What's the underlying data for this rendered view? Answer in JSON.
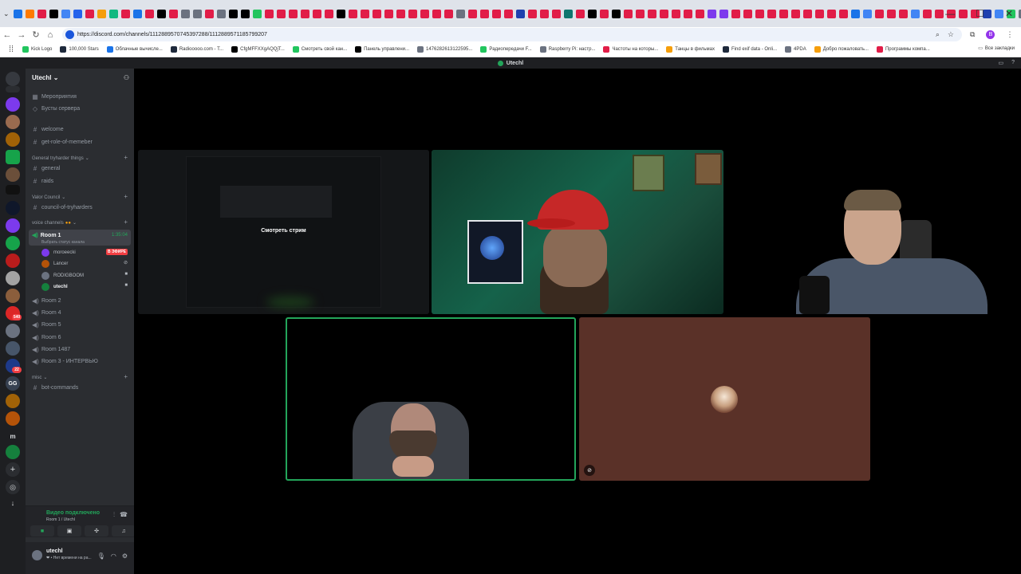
{
  "browser": {
    "url": "https://discord.com/channels/1112889570745397288/1112889571185799207",
    "tab_colors": [
      "#1a73e8",
      "#ff7a00",
      "#e11d48",
      "#000000",
      "#4285f4",
      "#2563eb",
      "#e11d48",
      "#f59e0b",
      "#10b981",
      "#e11d48",
      "#1a73e8",
      "#e11d48",
      "#000000",
      "#e11d48",
      "#6b7280",
      "#6b7280",
      "#e11d48",
      "#6b7280",
      "#000000",
      "#000000",
      "#22c55e",
      "#e11d48",
      "#e11d48",
      "#e11d48",
      "#e11d48",
      "#e11d48",
      "#e11d48",
      "#000000",
      "#e11d48",
      "#e11d48",
      "#e11d48",
      "#e11d48",
      "#e11d48",
      "#e11d48",
      "#e11d48",
      "#e11d48",
      "#e11d48",
      "#6b7280",
      "#e11d48",
      "#e11d48",
      "#e11d48",
      "#e11d48",
      "#1e40af",
      "#e11d48",
      "#e11d48",
      "#e11d48",
      "#0f766e",
      "#e11d48",
      "#000000",
      "#e11d48",
      "#000000",
      "#e11d48",
      "#e11d48",
      "#e11d48",
      "#e11d48",
      "#e11d48",
      "#e11d48",
      "#e11d48",
      "#7c3aed",
      "#7c3aed",
      "#e11d48",
      "#e11d48",
      "#e11d48",
      "#e11d48",
      "#e11d48",
      "#e11d48",
      "#e11d48",
      "#e11d48",
      "#e11d48",
      "#e11d48",
      "#1a73e8",
      "#4285f4",
      "#e11d48",
      "#e11d48",
      "#e11d48",
      "#4285f4",
      "#e11d48",
      "#e11d48",
      "#e11d48",
      "#e11d48",
      "#e11d48",
      "#1e40af",
      "#4285f4",
      "#22c55e",
      "#6b7280"
    ],
    "bookmarks": [
      {
        "label": "Kick Logo",
        "color": "#22c55e"
      },
      {
        "label": "100,000 Stars",
        "color": "#1e293b"
      },
      {
        "label": "Облачные вычисле...",
        "color": "#1a73e8"
      },
      {
        "label": "Radiooooo.com - T...",
        "color": "#1e293b"
      },
      {
        "label": "CfgMFFXXgAQQjT...",
        "color": "#000000"
      },
      {
        "label": "Смотреть свой кан...",
        "color": "#22c55e"
      },
      {
        "label": "Панель управлени...",
        "color": "#000000"
      },
      {
        "label": "1476282613122595...",
        "color": "#6b7280"
      },
      {
        "label": "Радиопередачи F...",
        "color": "#22c55e"
      },
      {
        "label": "Raspberry Pi: настр...",
        "color": "#6b7280"
      },
      {
        "label": "Частоты на которы...",
        "color": "#e11d48"
      },
      {
        "label": "Танцы в фильмах",
        "color": "#f59e0b"
      },
      {
        "label": "Find exif data - Onli...",
        "color": "#1e293b"
      },
      {
        "label": "4PDA",
        "color": "#6b7280"
      },
      {
        "label": "Добро пожаловать...",
        "color": "#f59e0b"
      },
      {
        "label": "Программы компа...",
        "color": "#e11d48"
      }
    ],
    "all_bookmarks": "Все закладки",
    "profile_letter": "B"
  },
  "window": {
    "title": "Utechl"
  },
  "rail": {
    "badges": [
      "540",
      "22"
    ]
  },
  "guild": {
    "name": "Utechl",
    "chevron": "⌄"
  },
  "sidebar": {
    "top_items": [
      "Мероприятия",
      "Бусты сервера"
    ],
    "channels1": [
      "welcome",
      "get-role-of-memeber"
    ],
    "cat_general": "General tryharder things",
    "channels2": [
      "general",
      "raids"
    ],
    "cat_valor": "Valor Council",
    "channels3": [
      "council-of-tryharders"
    ],
    "cat_voice": "voice channels",
    "room1": {
      "name": "Room 1",
      "time": "1:35:04",
      "status": "Выбрать статус канала"
    },
    "members": [
      {
        "name": "moroeecki",
        "live": "В ЭФИРЕ",
        "avatar": "#7c3aed"
      },
      {
        "name": "Lancer",
        "avatar": "#b45309"
      },
      {
        "name": "RODIGBOOM",
        "avatar": "#6b7280"
      },
      {
        "name": "utechl",
        "avatar": "#15803d"
      }
    ],
    "rooms": [
      "Room 2",
      "Room 4",
      "Room 5",
      "Room 6",
      "Room 1487",
      "Room 3 - ИНТЕРВЬЮ"
    ],
    "cat_misc": "misc",
    "channels4": [
      "bot-commands"
    ],
    "voice_status": "Видео подключено",
    "voice_sub": "Room 1 / Utechl",
    "user": {
      "name": "utechl",
      "status": "❤ • Нет времени на ра..."
    }
  },
  "stage": {
    "screen_label": "Смотреть стрим"
  }
}
